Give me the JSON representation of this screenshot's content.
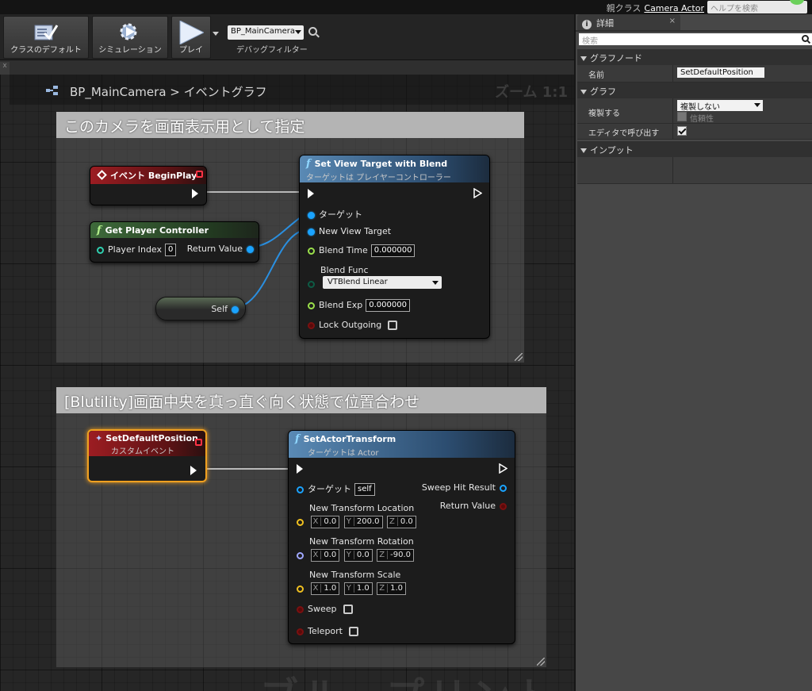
{
  "topbar": {
    "parent_class_label": "親クラス",
    "parent_class_value": "Camera Actor",
    "help_search_placeholder": "ヘルプを検索"
  },
  "toolbar": {
    "class_defaults_label": "クラスのデフォルト",
    "simulation_label": "シミュレーション",
    "play_label": "プレイ",
    "debug_object_value": "BP_MainCamera",
    "debug_filter_label": "デバッグフィルター"
  },
  "graph": {
    "tab_label": "x",
    "breadcrumb_blueprint": "BP_MainCamera",
    "breadcrumb_sep": ">",
    "breadcrumb_graph": "イベントグラフ",
    "zoom_label": "ズーム 1:1",
    "watermark": "ブループリント",
    "comment1_title": "このカメラを画面表示用として指定",
    "comment2_title": "[Blutility]画面中央を真っ直ぐ向く状態で位置合わせ"
  },
  "nodes": {
    "begin_play": {
      "title": "イベント BeginPlay"
    },
    "get_player_controller": {
      "title": "Get Player Controller",
      "player_index_label": "Player Index",
      "player_index_value": "0",
      "return_value_label": "Return Value"
    },
    "self_node": {
      "label": "Self"
    },
    "set_view_target": {
      "title": "Set View Target with Blend",
      "subtitle": "ターゲットは プレイヤーコントローラー",
      "target_label": "ターゲット",
      "new_view_target_label": "New View Target",
      "blend_time_label": "Blend Time",
      "blend_time_value": "0.000000",
      "blend_func_label": "Blend Func",
      "blend_func_value": "VTBlend Linear",
      "blend_exp_label": "Blend Exp",
      "blend_exp_value": "0.000000",
      "lock_outgoing_label": "Lock Outgoing"
    },
    "set_default_position": {
      "title": "SetDefaultPosition",
      "subtitle": "カスタムイベント"
    },
    "set_actor_transform": {
      "title": "SetActorTransform",
      "subtitle": "ターゲットは Actor",
      "target_label": "ターゲット",
      "target_value": "self",
      "sweep_hit_label": "Sweep Hit Result",
      "return_value_label": "Return Value",
      "location_label": "New Transform Location",
      "location": {
        "x": "0.0",
        "y": "200.0",
        "z": "0.0"
      },
      "rotation_label": "New Transform Rotation",
      "rotation": {
        "x": "0.0",
        "y": "0.0",
        "z": "-90.0"
      },
      "scale_label": "New Transform Scale",
      "scale": {
        "x": "1.0",
        "y": "1.0",
        "z": "1.0"
      },
      "sweep_label": "Sweep",
      "teleport_label": "Teleport",
      "axis_x": "X",
      "axis_y": "Y",
      "axis_z": "Z"
    }
  },
  "details": {
    "tab_label": "詳細",
    "tab_close": "×",
    "search_placeholder": "検索",
    "graph_node_category": "グラフノード",
    "name_label": "名前",
    "name_value": "SetDefaultPosition",
    "graph_category": "グラフ",
    "replicate_label": "複製する",
    "replicate_value": "複製しない",
    "reliable_label": "信頼性",
    "call_in_editor_label": "エディタで呼び出す",
    "inputs_category": "インプット"
  },
  "colors": {
    "event_header": "#9c1d22",
    "pure_header": "#3e6a3a",
    "function_header": "#5a8ab5",
    "object_pin": "#1aa3ff",
    "float_pin": "#9ae04a",
    "vector_pin": "#f0c020",
    "rotator_pin": "#a0a8ff",
    "bool_pin": "#c01a1a",
    "selection": "#f0a020"
  }
}
